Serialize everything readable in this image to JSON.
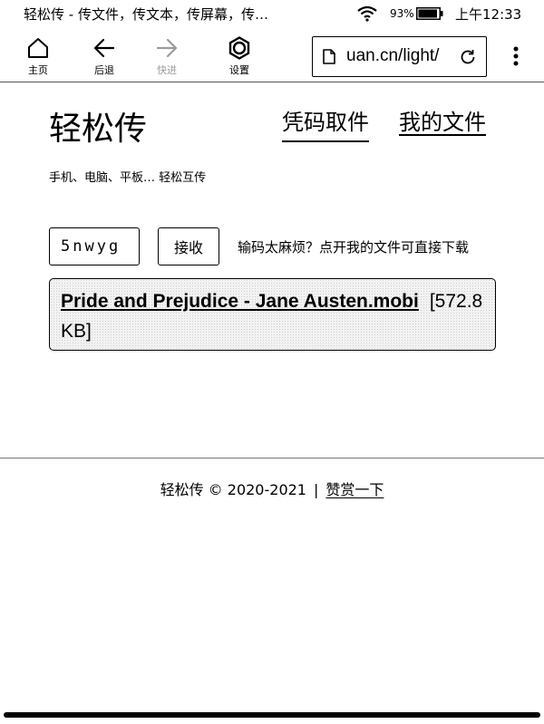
{
  "status_bar": {
    "title": "轻松传 - 传文件，传文本，传屏幕，传…",
    "battery_percent": "93%",
    "battery_level": 0.93,
    "time": "上午12:33",
    "icons": [
      "wifi-icon",
      "battery-icon"
    ]
  },
  "toolbar": {
    "home_label": "主页",
    "back_label": "后退",
    "forward_label": "快进",
    "settings_label": "设置",
    "url": "uan.cn/light/",
    "icons": [
      "home-icon",
      "arrow-left-icon",
      "arrow-right-icon",
      "gear-icon",
      "document-icon",
      "reload-icon",
      "more-vertical-icon"
    ]
  },
  "header": {
    "site_title": "轻松传",
    "nav": {
      "code_link": "凭码取件",
      "my_files_link": "我的文件"
    },
    "tagline": "手机、电脑、平板… 轻松互传"
  },
  "receive": {
    "code_value": "5nwyg",
    "button_label": "接收",
    "hint": "输码太麻烦？点开我的文件可直接下载"
  },
  "file": {
    "name": "Pride and Prejudice - Jane Austen.mobi",
    "size": "[572.8 KB]"
  },
  "footer": {
    "text": "轻松传 © 2020-2021",
    "separator": "|",
    "donate_link": "赞赏一下"
  },
  "colors": {
    "background": "#ffffff",
    "text": "#000000",
    "disabled": "#9a9a9a",
    "card_bg": "#f2f2f2"
  }
}
